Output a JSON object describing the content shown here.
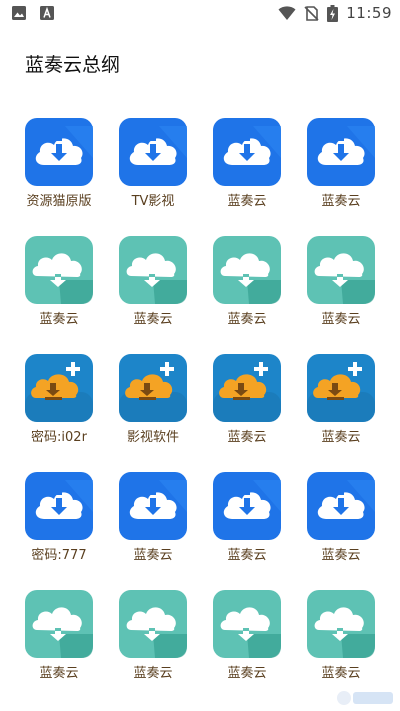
{
  "status_bar": {
    "time": "11:59"
  },
  "page": {
    "title": "蓝奏云总纲"
  },
  "colors": {
    "blue": "#1f74e8",
    "teal": "#5ec2b4",
    "orange_tile": "#1d85c9",
    "label": "#5a3f1f"
  },
  "apps": [
    {
      "label": "资源猫原版",
      "icon": "blue-cloud-download-icon"
    },
    {
      "label": "TV影视",
      "icon": "blue-cloud-download-icon"
    },
    {
      "label": "蓝奏云",
      "icon": "blue-cloud-download-icon"
    },
    {
      "label": "蓝奏云",
      "icon": "blue-cloud-download-icon"
    },
    {
      "label": "蓝奏云",
      "icon": "teal-cloud-download-icon"
    },
    {
      "label": "蓝奏云",
      "icon": "teal-cloud-download-icon"
    },
    {
      "label": "蓝奏云",
      "icon": "teal-cloud-download-icon"
    },
    {
      "label": "蓝奏云",
      "icon": "teal-cloud-download-icon"
    },
    {
      "label": "密码:i02r",
      "icon": "orange-cloud-download-plus-icon"
    },
    {
      "label": "影视软件",
      "icon": "orange-cloud-download-plus-icon"
    },
    {
      "label": "蓝奏云",
      "icon": "orange-cloud-download-plus-icon"
    },
    {
      "label": "蓝奏云",
      "icon": "orange-cloud-download-plus-icon"
    },
    {
      "label": "密码:777",
      "icon": "blue-cloud-download-icon"
    },
    {
      "label": "蓝奏云",
      "icon": "blue-cloud-download-icon"
    },
    {
      "label": "蓝奏云",
      "icon": "blue-cloud-download-icon"
    },
    {
      "label": "蓝奏云",
      "icon": "blue-cloud-download-icon"
    },
    {
      "label": "蓝奏云",
      "icon": "teal-cloud-download-icon"
    },
    {
      "label": "蓝奏云",
      "icon": "teal-cloud-download-icon"
    },
    {
      "label": "蓝奏云",
      "icon": "teal-cloud-download-icon"
    },
    {
      "label": "蓝奏云",
      "icon": "teal-cloud-download-icon"
    }
  ]
}
